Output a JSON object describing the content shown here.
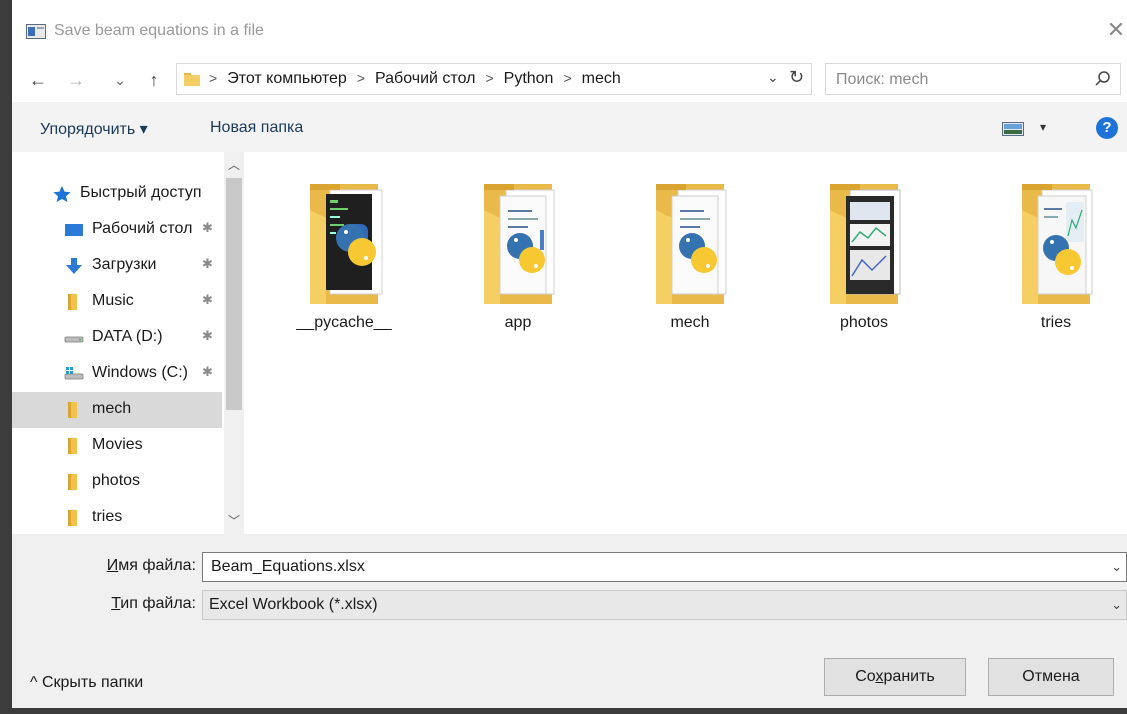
{
  "window": {
    "title": "Save beam equations in a file",
    "close_glyph": "✕"
  },
  "nav": {
    "back_glyph": "←",
    "forward_glyph": "→",
    "recent_glyph": "⌄",
    "up_glyph": "↑",
    "breadcrumbs": [
      "Этот компьютер",
      "Рабочий стол",
      "Python",
      "mech"
    ],
    "refresh_glyph": "↻",
    "dropdown_glyph": "⌄",
    "search_placeholder": "Поиск: mech"
  },
  "toolbar": {
    "organize": "Упорядочить ▾",
    "new_folder": "Новая папка",
    "view_drop": "▾",
    "help": "?"
  },
  "sidebar": {
    "items": [
      {
        "label": "Быстрый доступ",
        "icon": "star-icon",
        "pinned": false
      },
      {
        "label": "Рабочий стол",
        "icon": "desktop-icon",
        "pinned": true
      },
      {
        "label": "Загрузки",
        "icon": "download-icon",
        "pinned": true
      },
      {
        "label": "Music",
        "icon": "folder-icon",
        "pinned": true
      },
      {
        "label": "DATA (D:)",
        "icon": "drive-icon",
        "pinned": true
      },
      {
        "label": "Windows (C:)",
        "icon": "windows-drive-icon",
        "pinned": true
      },
      {
        "label": "mech",
        "icon": "folder-icon",
        "pinned": false,
        "selected": true
      },
      {
        "label": "Movies",
        "icon": "folder-icon",
        "pinned": false
      },
      {
        "label": "photos",
        "icon": "folder-icon",
        "pinned": false
      },
      {
        "label": "tries",
        "icon": "folder-icon",
        "pinned": false
      }
    ],
    "pin_glyph": "📌",
    "scroll_up": "▲",
    "scroll_down": "▼"
  },
  "folders": [
    {
      "name": "__pycache__",
      "preview": "code"
    },
    {
      "name": "app",
      "preview": "doc"
    },
    {
      "name": "mech",
      "preview": "doc"
    },
    {
      "name": "photos",
      "preview": "screens"
    },
    {
      "name": "tries",
      "preview": "mixed"
    }
  ],
  "form": {
    "filename_label_u": "И",
    "filename_label_rest": "мя файла:",
    "filename_value": "Beam_Equations.xlsx",
    "filetype_label_u": "Т",
    "filetype_label_rest": "ип файла:",
    "filetype_value": "Excel Workbook (*.xlsx)",
    "chevron": "⌄",
    "hide_folders": "^ Скрыть папки",
    "save_pre": "Со",
    "save_u": "х",
    "save_post": "ранить",
    "cancel": "Отмена"
  }
}
